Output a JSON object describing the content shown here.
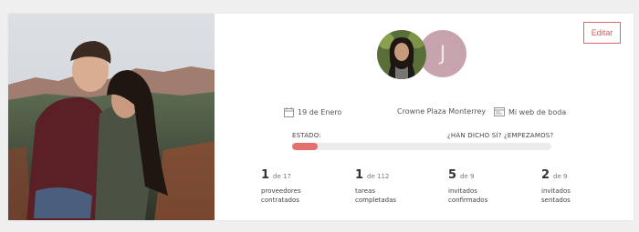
{
  "header": {
    "edit_label": "Editar"
  },
  "couple": {
    "initial": "J"
  },
  "event": {
    "date": "19 de Enero",
    "venue": "Crowne Plaza Monterrey",
    "website": "Mi web de boda"
  },
  "status": {
    "label": "ESTADO:",
    "cta": "¿HAN DICHO SÍ? ¿EMPEZAMOS?",
    "progress_fraction": 0.1
  },
  "stats": [
    {
      "value": "1",
      "total": "de 17",
      "label_line1": "proveedores",
      "label_line2": "contratados"
    },
    {
      "value": "1",
      "total": "de 112",
      "label_line1": "tareas",
      "label_line2": "completadas"
    },
    {
      "value": "5",
      "total": "de 9",
      "label_line1": "invitados",
      "label_line2": "confirmados"
    },
    {
      "value": "2",
      "total": "de 9",
      "label_line1": "invitados",
      "label_line2": "sentados"
    }
  ],
  "icons": {
    "date": "calendar-icon",
    "venue": "location-icon",
    "website": "web-icon"
  },
  "colors": {
    "accent": "#e36f70",
    "edit_border": "#d86767",
    "avatar_bg": "#c6a3ad"
  }
}
